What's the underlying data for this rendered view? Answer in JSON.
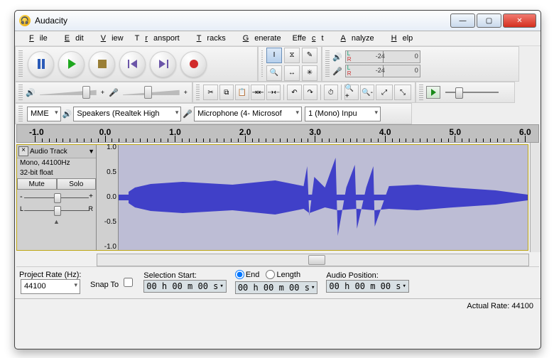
{
  "window": {
    "title": "Audacity"
  },
  "menus": [
    "File",
    "Edit",
    "View",
    "Transport",
    "Tracks",
    "Generate",
    "Effect",
    "Analyze",
    "Help"
  ],
  "meters": {
    "ticks": [
      "-24",
      "0"
    ]
  },
  "device": {
    "host": "MME",
    "output": "Speakers (Realtek High",
    "input": "Microphone (4- Microsof",
    "channels": "1 (Mono) Inpu"
  },
  "timeline": {
    "labels": [
      "-1.0",
      "0.0",
      "1.0",
      "2.0",
      "3.0",
      "4.0",
      "5.0",
      "6.0"
    ]
  },
  "track": {
    "name": "Audio Track",
    "format_line1": "Mono, 44100Hz",
    "format_line2": "32-bit float",
    "mute": "Mute",
    "solo": "Solo",
    "scale": [
      "1.0",
      "0.5",
      "0.0",
      "-0.5",
      "-1.0"
    ]
  },
  "bottom": {
    "project_rate_label": "Project Rate (Hz):",
    "project_rate": "44100",
    "snap_to": "Snap To",
    "sel_start_label": "Selection Start:",
    "end_label": "End",
    "length_label": "Length",
    "audio_pos_label": "Audio Position:",
    "time_value": "00 h 00 m 00 s"
  },
  "status": {
    "actual_rate": "Actual Rate: 44100"
  }
}
